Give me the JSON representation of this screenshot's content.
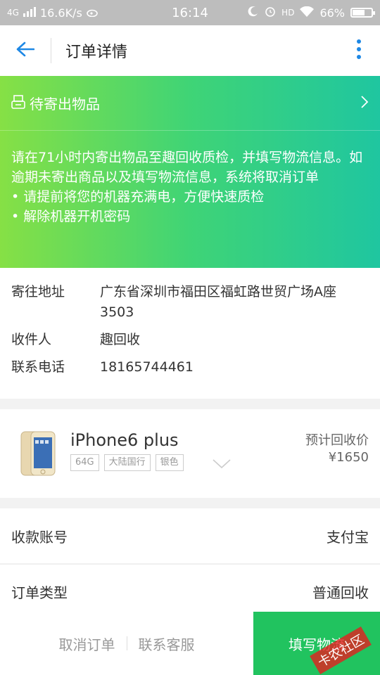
{
  "status_bar": {
    "network": "4G",
    "speed": "16.6K/s",
    "time": "16:14",
    "hd": "HD",
    "battery_percent": "66%",
    "battery_level": 0.66
  },
  "header": {
    "title": "订单详情",
    "back_icon": "arrow-left-icon",
    "more_icon": "more-vertical-icon"
  },
  "banner": {
    "title": "待寄出物品",
    "desc": "请在71小时内寄出物品至趣回收质检，并填写物流信息。如逾期未寄出商品以及填写物流信息，系统将取消订单",
    "bullets": [
      "• 请提前将您的机器充满电，方便快速质检",
      "• 解除机器开机密码"
    ]
  },
  "address": {
    "address_label": "寄往地址",
    "address_value": "广东省深圳市福田区福虹路世贸广场A座3503",
    "receiver_label": "收件人",
    "receiver_value": "趣回收",
    "phone_label": "联系电话",
    "phone_value": "18165744461"
  },
  "product": {
    "name": "iPhone6 plus",
    "tags": [
      "64G",
      "大陆国行",
      "银色"
    ],
    "price_label": "预计回收价",
    "price": "¥1650"
  },
  "info_rows": {
    "account_label": "收款账号",
    "account_value": "支付宝",
    "type_label": "订单类型",
    "type_value": "普通回收"
  },
  "bottom": {
    "cancel": "取消订单",
    "contact": "联系客服",
    "primary": "填写物流",
    "watermark": "卡农社区"
  },
  "colors": {
    "accent_blue": "#1e88e5",
    "primary_green": "#21c35f",
    "banner_start": "#86e045",
    "banner_end": "#1fc6a0"
  }
}
